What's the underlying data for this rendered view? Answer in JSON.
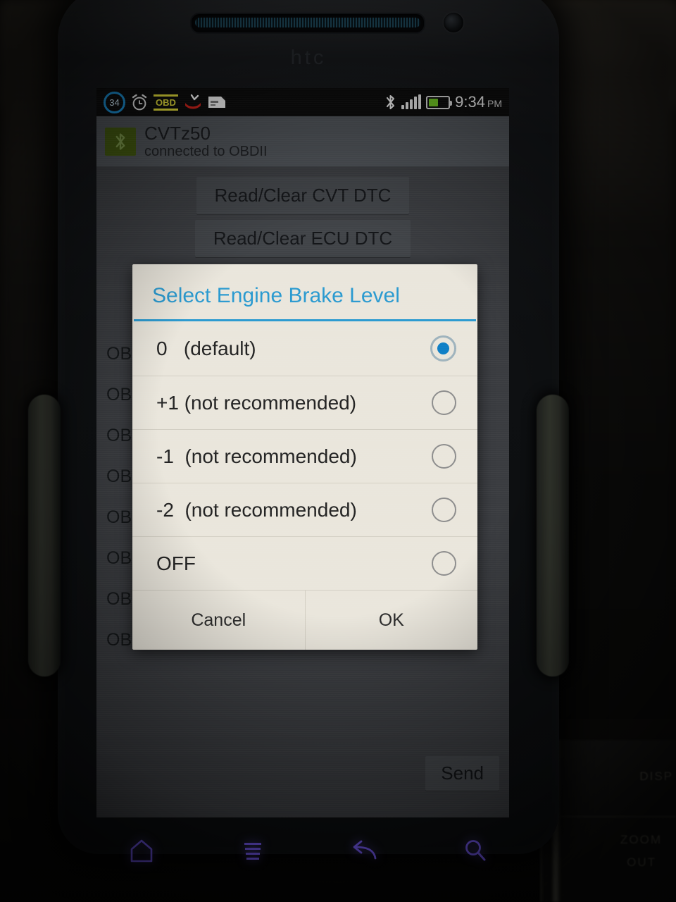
{
  "status_bar": {
    "notification_count": "34",
    "icons": [
      "notification-count-badge",
      "alarm-clock-icon",
      "obd-icon",
      "missed-call-icon",
      "sms-message-icon"
    ],
    "obd_label": "OBD",
    "bluetooth_icon": "bluetooth-icon",
    "signal_bars": 5,
    "battery_percent": 50,
    "time": "9:34",
    "meridiem": "PM"
  },
  "app_bar": {
    "icon": "bluetooth-connected-icon",
    "title": "CVTz50",
    "subtitle": "connected to OBDII"
  },
  "app_body": {
    "buttons": [
      {
        "label": "Read/Clear CVT DTC"
      },
      {
        "label": "Read/Clear ECU DTC"
      }
    ],
    "log_lines": [
      "OBDII:",
      "OBDII:",
      "OBDII:",
      "OBDII:",
      "OBDII:",
      "OBDII:",
      "OBDII:",
      "OBDII:  >"
    ],
    "send_label": "Send"
  },
  "dialog": {
    "title": "Select Engine Brake Level",
    "options": [
      {
        "label": "0   (default)",
        "selected": true
      },
      {
        "label": "+1 (not recommended)",
        "selected": false
      },
      {
        "label": "-1  (not recommended)",
        "selected": false
      },
      {
        "label": "-2  (not recommended)",
        "selected": false
      },
      {
        "label": "OFF",
        "selected": false
      }
    ],
    "cancel_label": "Cancel",
    "ok_label": "OK"
  },
  "device": {
    "brand_logo": "htc",
    "capacitive_keys": [
      "home-icon",
      "menu-icon",
      "back-icon",
      "search-icon"
    ]
  },
  "environment": {
    "dashboard_labels": [
      "DISP",
      "ZOOM",
      "OUT"
    ]
  },
  "colors": {
    "dialog_accent": "#2a9ad0",
    "radio_selected": "#0e7fc6",
    "capacitive_glow": "#7b5fff",
    "status_obd": "#e8e23a",
    "battery_fill": "#6fc423"
  }
}
